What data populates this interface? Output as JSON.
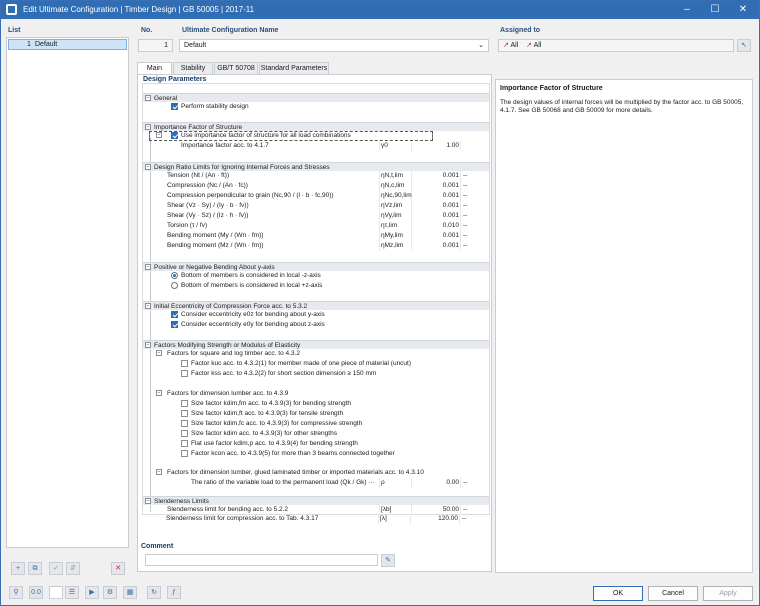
{
  "window": {
    "title": "Edit Ultimate Configuration | Timber Design | GB 50005 | 2017-11"
  },
  "list": {
    "label": "List",
    "items": [
      {
        "no": "1",
        "name": "Default"
      }
    ]
  },
  "header": {
    "no_label": "No.",
    "no_value": "1",
    "name_label": "Ultimate Configuration Name",
    "name_value": "Default",
    "assigned_label": "Assigned to",
    "assigned_value_1": "All",
    "assigned_value_2": "All"
  },
  "tabs": [
    "Main",
    "Stability",
    "GB/T 50708",
    "Standard Parameters"
  ],
  "params": {
    "title": "Design Parameters",
    "general": {
      "title": "General",
      "stability": "Perform stability design"
    },
    "importance": {
      "title": "Importance Factor of Structure",
      "use": "Use importance factor of structure for all load combinations",
      "factor_label": "Importance factor acc. to 4.1.7",
      "factor_sym": "γ0",
      "factor_val": "1.00"
    },
    "ratio": {
      "title": "Design Ratio Limits for Ignoring Internal Forces and Stresses",
      "rows": [
        {
          "label": "Tension (Nt / (An · ft))",
          "sym": "ηN,t,lim",
          "val": "0.001",
          "unit": "--"
        },
        {
          "label": "Compression (Nc / (An · fc))",
          "sym": "ηN,c,lim",
          "val": "0.001",
          "unit": "--"
        },
        {
          "label": "Compression perpendicular to grain (Nc,90 / (l · b · fc,90))",
          "sym": "ηNc,90,lim",
          "val": "0.001",
          "unit": "--"
        },
        {
          "label": "Shear (Vz · Sy) / (Iy · b · fv))",
          "sym": "ηVz,lim",
          "val": "0.001",
          "unit": "--"
        },
        {
          "label": "Shear (Vy · Sz) / (Iz · h · fv))",
          "sym": "ηVy,lim",
          "val": "0.001",
          "unit": "--"
        },
        {
          "label": "Torsion (τ / fv)",
          "sym": "ητ,lim",
          "val": "0.010",
          "unit": "--"
        },
        {
          "label": "Bending moment (My / (Wn · fm))",
          "sym": "ηMy,lim",
          "val": "0.001",
          "unit": "--"
        },
        {
          "label": "Bending moment (Mz / (Wn · fm))",
          "sym": "ηMz,lim",
          "val": "0.001",
          "unit": "--"
        }
      ]
    },
    "bending": {
      "title": "Positive or Negative Bending About y-axis",
      "opt1": "Bottom of members is considered in local -z-axis",
      "opt2": "Bottom of members is considered in local +z-axis"
    },
    "ecc": {
      "title": "Initial Eccentricity of Compression Force acc. to 5.3.2",
      "y": "Consider eccentricity e0z for bending about y-axis",
      "z": "Consider eccentricity e0y for bending about z-axis"
    },
    "mod": {
      "title": "Factors Modifying Strength or Modulus of Elasticity",
      "sq_title": "Factors for square and log timber acc. to 4.3.2",
      "sq1": "Factor kuc acc. to 4.3.2(1) for member made of one piece of material (uncut)",
      "sq2": "Factor kss acc. to 4.3.2(2) for short section dimension ≥ 150 mm",
      "dl_title": "Factors for dimension lumber acc. to 4.3.9",
      "dl": [
        "Size factor kdim,fm acc. to 4.3.9(3) for bending strength",
        "Size factor kdim,ft acc. to 4.3.9(3) for tensile strength",
        "Size factor kdim,fc acc. to 4.3.9(3) for compressive strength",
        "Size factor kdim acc. to 4.3.9(3) for other strengths",
        "Flat use factor kdim,p acc. to 4.3.9(4) for bending strength",
        "Factor kcon acc. to 4.3.9(5) for more than 3 beams connected together"
      ],
      "gl_title": "Factors for dimension lumber, glued laminated timber or imported materials acc. to 4.3.10",
      "gl_row": "The ratio of the variable load to the permanent load (Qk / Gk) ···",
      "gl_sym": "ρ",
      "gl_val": "0.00",
      "gl_unit": "--"
    },
    "slender": {
      "title": "Slenderness Limits",
      "rows": [
        {
          "label": "Slenderness limit for bending acc. to 5.2.2",
          "sym": "[λb]",
          "val": "50.00",
          "unit": "--"
        },
        {
          "label": "Slenderness limit for compression acc. to Tab. 4.3.17",
          "sym": "[λ]",
          "val": "120.00",
          "unit": "--"
        }
      ]
    }
  },
  "info": {
    "title": "Importance Factor of Structure",
    "body": "The design values of internal forces will be multiplied by the factor acc. to GB 50005, 4.1.7. See GB 50068 and GB 50009 for more details."
  },
  "comment": {
    "label": "Comment"
  },
  "buttons": {
    "ok": "OK",
    "cancel": "Cancel",
    "apply": "Apply"
  }
}
